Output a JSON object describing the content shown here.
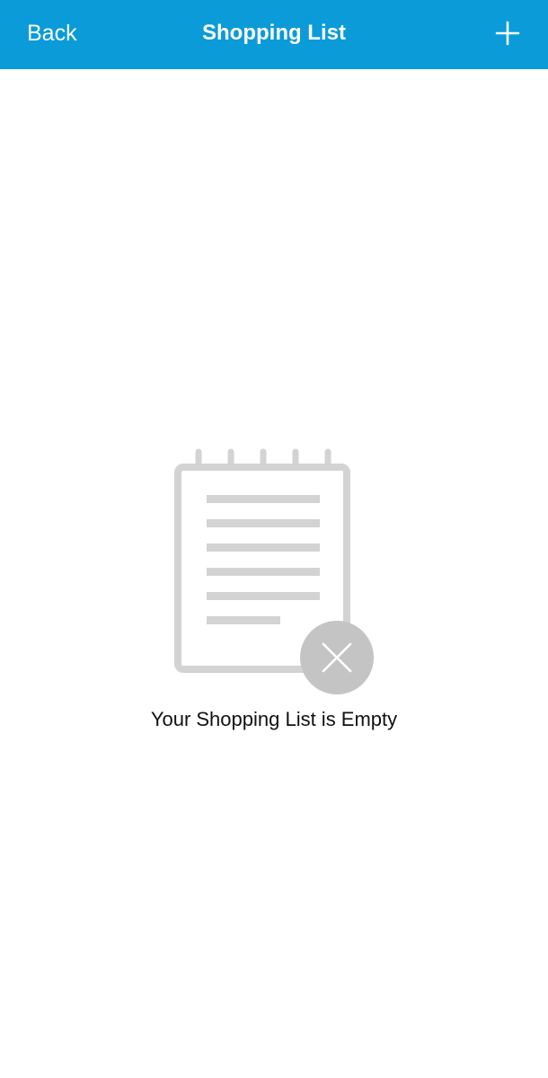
{
  "nav": {
    "back_label": "Back",
    "title": "Shopping List",
    "add_icon": "plus-icon"
  },
  "empty_state": {
    "icon": "empty-notepad-icon",
    "badge_icon": "close-icon",
    "message": "Your Shopping List is Empty"
  },
  "colors": {
    "nav_background": "#0a9bd8",
    "nav_text": "#ffffff",
    "illustration": "#d3d3d3",
    "badge": "#c4c4c4"
  }
}
